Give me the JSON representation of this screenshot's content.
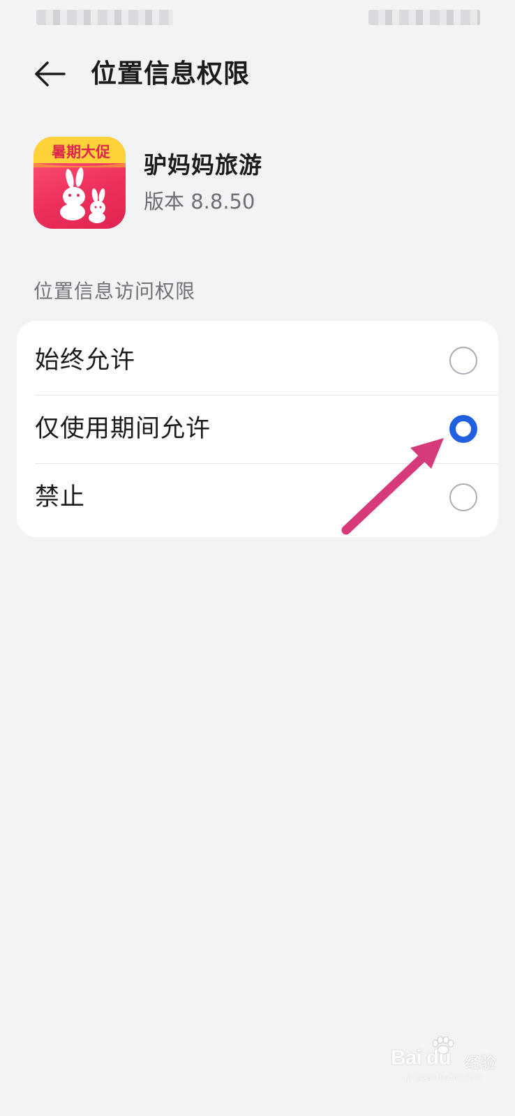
{
  "header": {
    "title": "位置信息权限",
    "back_icon": "back-arrow-icon"
  },
  "app": {
    "name": "驴妈妈旅游",
    "version": "版本 8.8.50",
    "icon_badge_text": "暑期大促",
    "icon": "donkey-rabbit-app-icon"
  },
  "section": {
    "title": "位置信息访问权限"
  },
  "options": [
    {
      "label": "始终允许",
      "selected": false
    },
    {
      "label": "仅使用期间允许",
      "selected": true
    },
    {
      "label": "禁止",
      "selected": false
    }
  ],
  "annotation": {
    "type": "arrow",
    "color": "#d63a7a",
    "points_to": "仅使用期间允许"
  },
  "watermark": {
    "logo": "Bai du",
    "text": "经验",
    "url": "jingyan.baidu.com"
  },
  "colors": {
    "background": "#f1f3f5",
    "card": "#ffffff",
    "accent": "#1f5fe0",
    "secondary_text": "#6b6e72"
  }
}
